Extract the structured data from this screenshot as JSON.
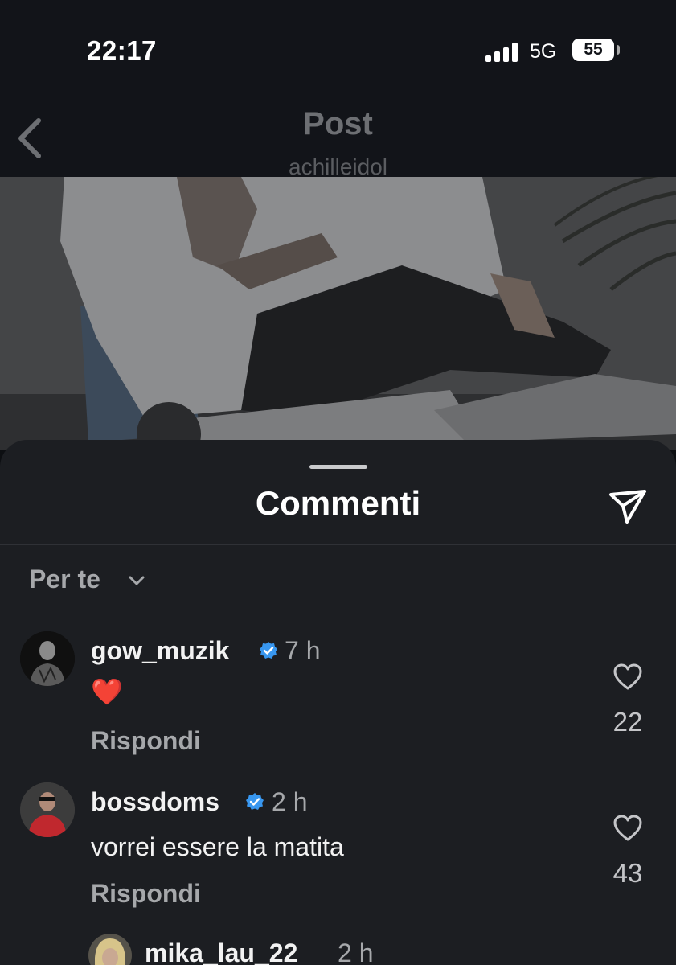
{
  "status_bar": {
    "time": "22:17",
    "network": "5G",
    "battery": "55"
  },
  "nav": {
    "title": "Post",
    "subtitle": "achilleidol",
    "back_icon": "chevron-left-icon"
  },
  "sheet": {
    "title": "Commenti",
    "share_icon": "paper-plane-icon",
    "filter_label": "Per te",
    "filter_icon": "chevron-down-icon"
  },
  "comments": [
    {
      "username": "gow_muzik",
      "verified": true,
      "time": "7 h",
      "text": "❤️",
      "reply_label": "Rispondi",
      "likes": "22"
    },
    {
      "username": "bossdoms",
      "verified": true,
      "time": "2 h",
      "text": "vorrei essere la matita",
      "reply_label": "Rispondi",
      "likes": "43"
    },
    {
      "username": "mika_lau_22",
      "verified": false,
      "time": "2 h"
    }
  ],
  "colors": {
    "verified": "#3897f0",
    "heart_red": "#e0245e",
    "sheet_bg": "#1c1e22"
  }
}
